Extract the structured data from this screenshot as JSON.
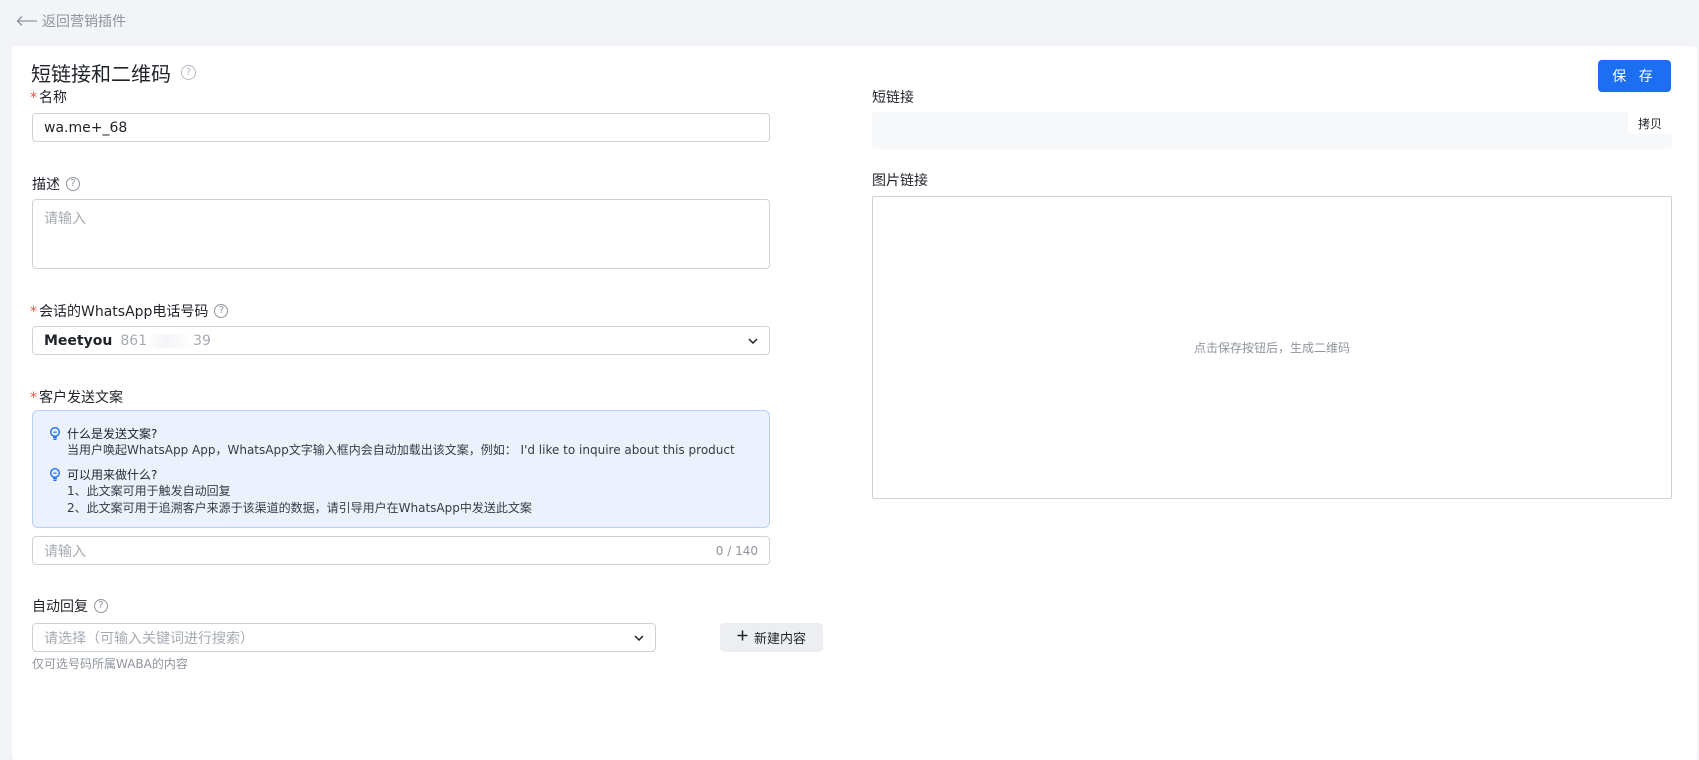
{
  "nav": {
    "back_label": "返回营销插件"
  },
  "header": {
    "title": "短链接和二维码",
    "save_label": "保 存"
  },
  "form": {
    "name": {
      "label": "名称",
      "value": "wa.me+_68"
    },
    "description": {
      "label": "描述",
      "placeholder": "请输入"
    },
    "phone": {
      "label": "会话的WhatsApp电话号码",
      "account": "Meetyou",
      "number_prefix": "861",
      "number_suffix": "39"
    },
    "customer_message": {
      "label": "客户发送文案",
      "tip1_title": "什么是发送文案?",
      "tip1_text": "当用户唤起WhatsApp App，WhatsApp文字输入框内会自动加载出该文案，例如： I'd like to inquire about this product",
      "tip2_title": "可以用来做什么?",
      "tip2_line1": "1、此文案可用于触发自动回复",
      "tip2_line2": "2、此文案可用于追溯客户来源于该渠道的数据，请引导用户在WhatsApp中发送此文案",
      "placeholder": "请输入",
      "counter": "0 / 140"
    },
    "auto_reply": {
      "label": "自动回复",
      "placeholder": "请选择（可输入关键词进行搜索）",
      "new_label": "新建内容",
      "hint": "仅可选号码所属WABA的内容"
    }
  },
  "right": {
    "short_link_label": "短链接",
    "copy_label": "拷贝",
    "image_link_label": "图片链接",
    "qr_hint": "点击保存按钮后，生成二维码"
  },
  "colors": {
    "primary": "#1d6ff2",
    "required": "#f54a45",
    "tip_bg": "#ebf2fe"
  }
}
